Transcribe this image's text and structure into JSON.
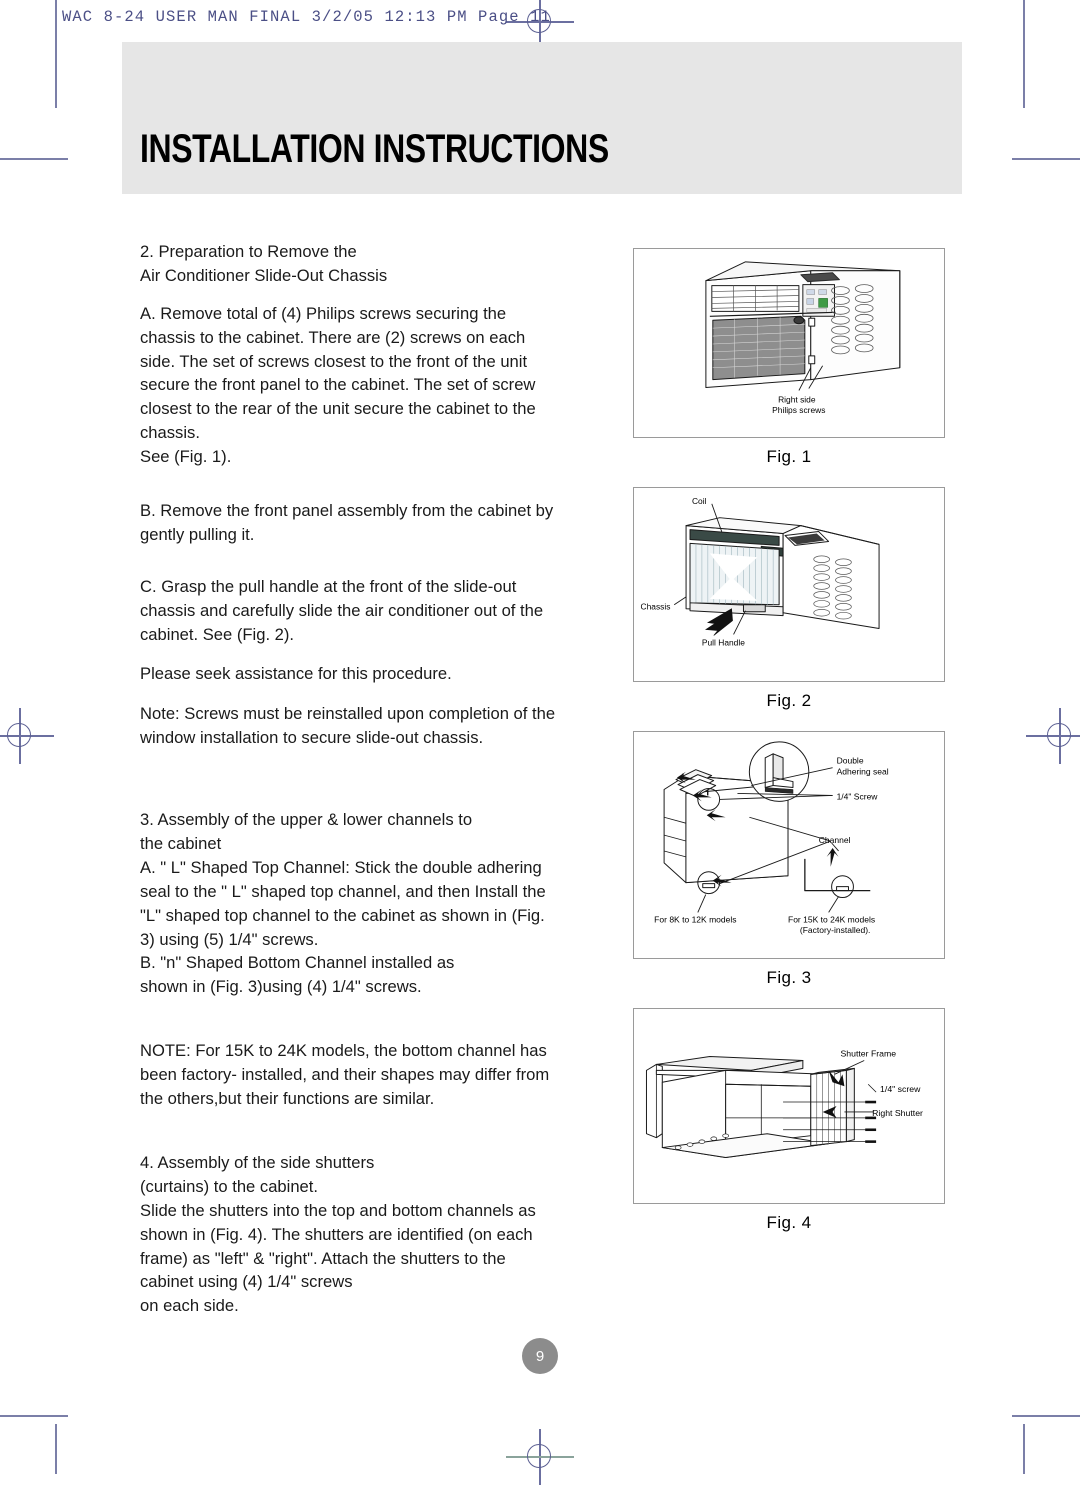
{
  "imprint": "WAC 8-24 USER MAN FINAL  3/2/05  12:13 PM  Page 11",
  "title": "INSTALLATION INSTRUCTIONS",
  "page_number": "9",
  "body": {
    "p1": "2. Preparation to Remove the\nAir Conditioner Slide-Out Chassis",
    "p2": "A. Remove total of  (4) Philips screws securing the chassis to the cabinet. There are (2) screws on each side. The set of screws closest to the front of the unit secure the front panel to the cabinet. The set of screw closest to the rear of the unit secure the cabinet to the chassis.\nSee (Fig. 1).",
    "p3": "B. Remove the front panel assembly from the cabinet by  gently pulling it.",
    "p4": "C. Grasp the pull handle at the front of the slide-out chassis and carefully slide the air conditioner out of the cabinet. See (Fig. 2).",
    "p5": "Please seek assistance for this procedure.",
    "p6": "Note: Screws must be reinstalled upon completion of the window installation to secure slide-out chassis.",
    "p7": "3. Assembly of the upper & lower channels to\nthe cabinet",
    "p8": "A. \" L\" Shaped Top Channel: Stick the double adhering seal to the \" L\" shaped top channel, and then Install the \"L\" shaped top channel to the cabinet as shown in (Fig. 3) using (5) 1/4\" screws.",
    "p9": "B. \"n\" Shaped Bottom Channel installed as\nshown in (Fig. 3)using (4) 1/4\" screws.",
    "p10": "NOTE: For 15K to 24K  models, the bottom channel has been factory- installed, and their shapes may differ from the others,but their functions  are similar.",
    "p11": "4. Assembly of the side shutters\n(curtains) to the cabinet.",
    "p12": "Slide the shutters into the top and bottom channels as shown in (Fig. 4). The shutters are identified (on each frame) as \"left\" & \"right\".  Attach the shutters to the cabinet using (4) 1/4\" screws\non each side."
  },
  "figures": [
    {
      "id": "fig1",
      "caption": "Fig. 1",
      "labels": {
        "right_side": "Right side",
        "philips_screws": "Philips screws"
      }
    },
    {
      "id": "fig2",
      "caption": "Fig. 2",
      "labels": {
        "coil": "Coil",
        "chassis": "Chassis",
        "pull_handle": "Pull Handle"
      }
    },
    {
      "id": "fig3",
      "caption": "Fig. 3",
      "labels": {
        "double": "Double",
        "adhering_seal": "Adhering seal",
        "screw": "1/4\" Screw",
        "channel": "Channel",
        "models_8k": "For 8K to 12K models",
        "models_15k": "For 15K to 24K models",
        "factory": "(Factory-installed)."
      }
    },
    {
      "id": "fig4",
      "caption": "Fig. 4",
      "labels": {
        "shutter_frame": "Shutter Frame",
        "screw": "1/4\" screw",
        "right_shutter": "Right Shutter"
      }
    }
  ],
  "colors": {
    "band": "#e6e6e6",
    "imprint": "#4b4f86",
    "regmark": "#6b6fa0",
    "pagenum_bg": "#8c8c8c",
    "figure_border": "#9a9a9a"
  }
}
